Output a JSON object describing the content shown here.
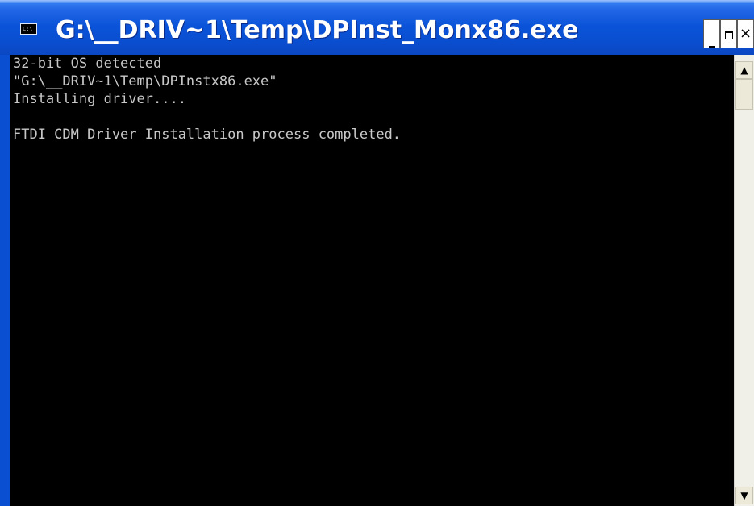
{
  "window": {
    "title": "G:\\__DRIV~1\\Temp\\DPInst_Monx86.exe",
    "icon": "console-icon",
    "icon_text": "C:\\",
    "controls": {
      "minimize_icon": "minimize-icon",
      "maximize_icon": "maximize-icon",
      "close_icon": "close-icon",
      "close_glyph": "×"
    }
  },
  "console": {
    "lines": [
      "32-bit OS detected",
      "\"G:\\__DRIV~1\\Temp\\DPInstx86.exe\"",
      "Installing driver....",
      "",
      "FTDI CDM Driver Installation process completed."
    ],
    "background": "#000000",
    "foreground": "#c8c8c8"
  },
  "scrollbar": {
    "up_arrow": "▲",
    "down_arrow": "▼"
  },
  "colors": {
    "title_bar": "#0a53d8",
    "title_text": "#ffffff"
  }
}
